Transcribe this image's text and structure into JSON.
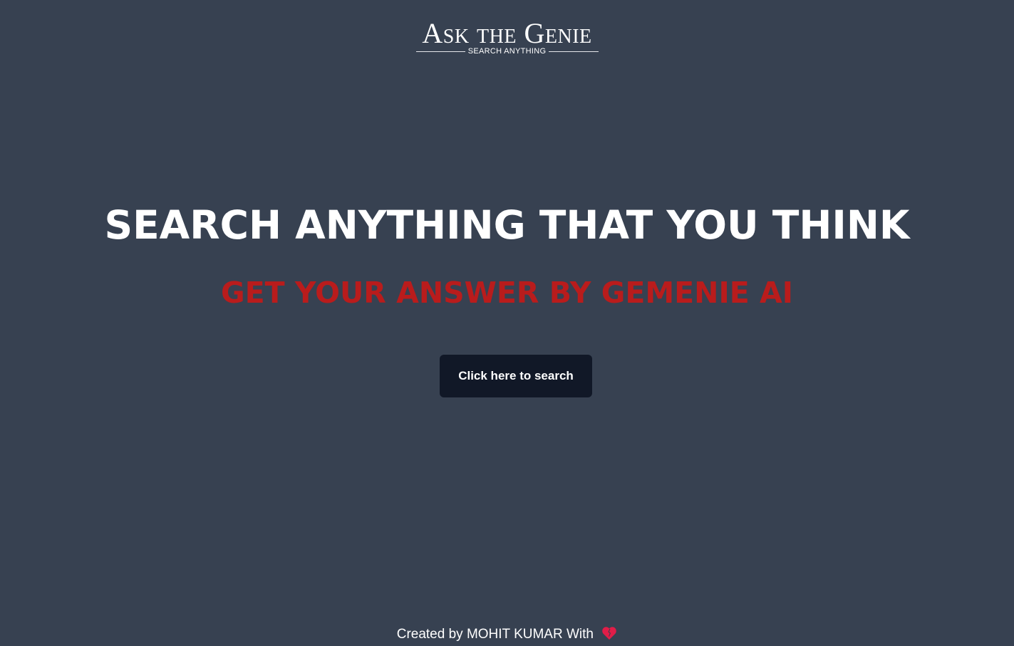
{
  "header": {
    "logo_title": "Ask the Genie",
    "logo_tagline": "SEARCH ANYTHING"
  },
  "hero": {
    "headline": "SEARCH ANYTHING THAT YOU THINK",
    "subheadline": "GET YOUR ANSWER BY GEMENIE AI",
    "search_button_label": "Click here to search"
  },
  "footer": {
    "credit_text": "Created by MOHIT KUMAR With",
    "icon": "heart-icon"
  },
  "colors": {
    "background": "#374151",
    "accent_red": "#b91c1c",
    "button_bg": "#111827",
    "text": "#ffffff",
    "heart": "#e11d48"
  }
}
